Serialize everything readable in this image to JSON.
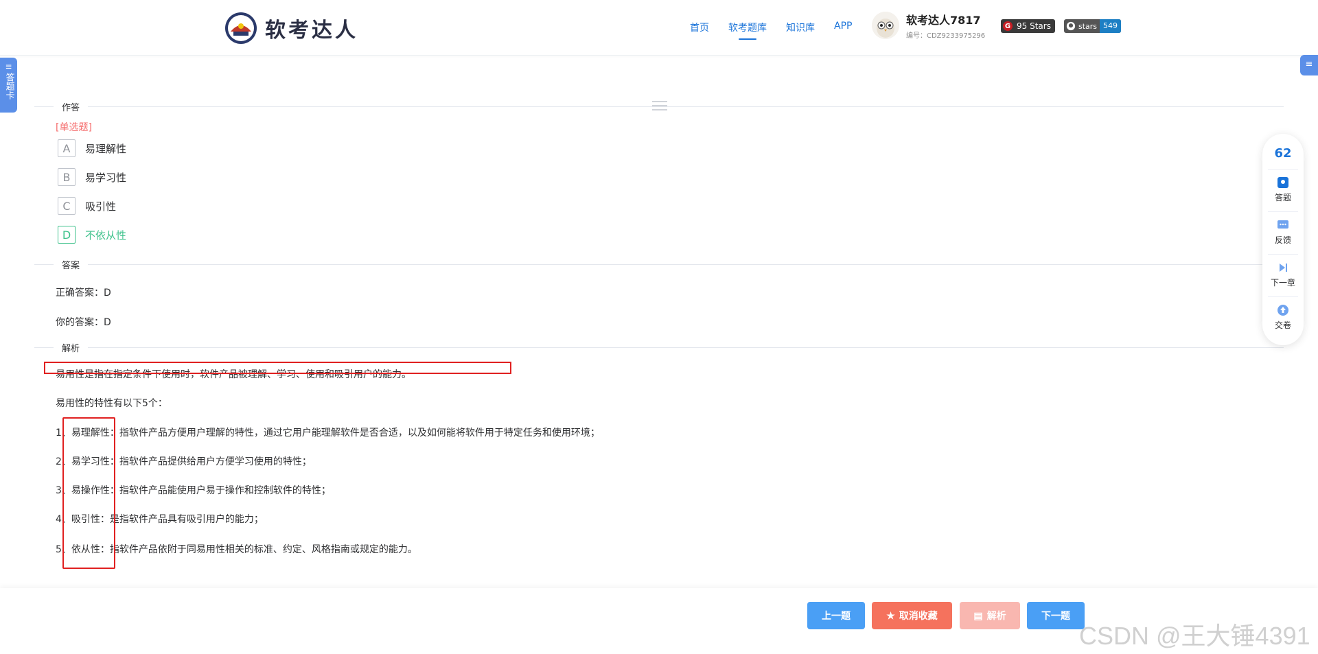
{
  "header": {
    "logo_text": "软考达人",
    "nav": [
      "首页",
      "软考题库",
      "知识库",
      "APP"
    ],
    "active_nav_index": 1,
    "user_name": "软考达人7817",
    "user_id": "编号：CDZ9233975296",
    "gitee_stars": "95 Stars",
    "github_label": "stars",
    "github_count": "549"
  },
  "left_tab": {
    "label": "答题卡"
  },
  "sections": {
    "answer_area": "作答",
    "answer": "答案",
    "analysis": "解析"
  },
  "question": {
    "type": "[单选题]",
    "options": [
      {
        "letter": "A",
        "text": "易理解性"
      },
      {
        "letter": "B",
        "text": "易学习性"
      },
      {
        "letter": "C",
        "text": "吸引性"
      },
      {
        "letter": "D",
        "text": "不依从性"
      }
    ],
    "correct_option": "D"
  },
  "answer": {
    "correct": "正确答案：D",
    "yours": "你的答案：D"
  },
  "analysis": {
    "paragraphs": [
      "易用性是指在指定条件下使用时，软件产品被理解、学习、使用和吸引用户的能力。",
      "易用性的特性有以下5个：",
      "1、易理解性：指软件产品方便用户理解的特性，通过它用户能理解软件是否合适，以及如何能将软件用于特定任务和使用环境；",
      "2、易学习性：指软件产品提供给用户方便学习使用的特性；",
      "3、易操作性：指软件产品能使用户易于操作和控制软件的特性；",
      "4、吸引性：是指软件产品具有吸引用户的能力；",
      "5、依从性：指软件产品依附于同易用性相关的标准、约定、风格指南或规定的能力。"
    ]
  },
  "float_panel": {
    "count": "62",
    "items": [
      "答题",
      "反馈",
      "下一章",
      "交卷"
    ]
  },
  "bottom": {
    "prev": "上一题",
    "fav": "取消收藏",
    "analysis": "解析",
    "next": "下一题"
  },
  "watermark": "CSDN @王大锤4391",
  "colors": {
    "accent": "#1a73d9",
    "correct": "#3fc28c",
    "question_type": "#f56c6c",
    "fav_button": "#f5725d",
    "highlight_box": "#e02020"
  }
}
